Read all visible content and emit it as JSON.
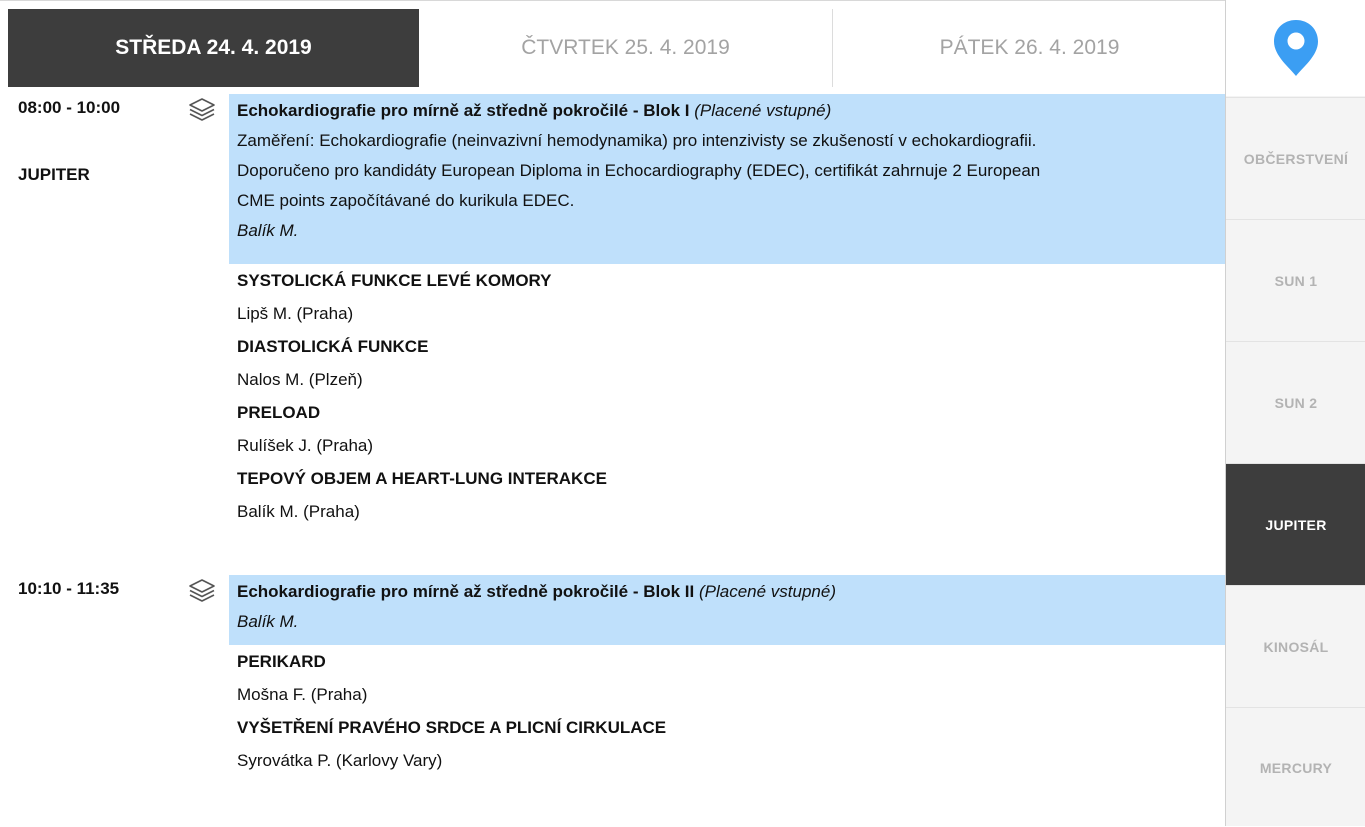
{
  "tabs": [
    {
      "label": "STŘEDA 24. 4. 2019",
      "active": true
    },
    {
      "label": "ČTVRTEK 25. 4. 2019",
      "active": false
    },
    {
      "label": "PÁTEK 26. 4. 2019",
      "active": false
    }
  ],
  "sidebar": {
    "pin_icon": "map-pin-icon",
    "rooms": [
      "OBČERSTVENÍ",
      "SUN 1",
      "SUN 2",
      "JUPITER",
      "KINOSÁL",
      "MERCURY"
    ],
    "active_room": "JUPITER"
  },
  "colors": {
    "active": "#3d3d3d",
    "session_bg": "#bfe0fb",
    "pin": "#3b9ef3"
  },
  "blocks": [
    {
      "time": "08:00 - 10:00",
      "room": "JUPITER",
      "icon": "layers-icon",
      "session": {
        "title": "Echokardiografie pro mírně až středně pokročilé - Blok I",
        "note": "(Placené vstupné)",
        "description": [
          "Zaměření: Echokardiografie (neinvazivní hemodynamika) pro intenzivisty se zkušeností v echokardiografii.",
          "Doporučeno pro kandidáty European Diploma in Echocardiography (EDEC), certifikát zahrnuje 2 European",
          "CME points započítávané do kurikula EDEC."
        ],
        "chair": "Balík M."
      },
      "talks": [
        {
          "title": "SYSTOLICKÁ FUNKCE LEVÉ KOMORY",
          "speaker": "Lipš M. (Praha)"
        },
        {
          "title": "DIASTOLICKÁ FUNKCE",
          "speaker": "Nalos M. (Plzeň)"
        },
        {
          "title": "PRELOAD",
          "speaker": "Rulíšek J. (Praha)"
        },
        {
          "title": "TEPOVÝ OBJEM A HEART-LUNG INTERAKCE",
          "speaker": "Balík M. (Praha)"
        }
      ]
    },
    {
      "time": "10:10 - 11:35",
      "icon": "layers-icon",
      "session": {
        "title": "Echokardiografie pro mírně až středně pokročilé - Blok II",
        "note": "(Placené vstupné)",
        "chair": "Balík M."
      },
      "talks": [
        {
          "title": "PERIKARD",
          "speaker": "Mošna F. (Praha)"
        },
        {
          "title": "VYŠETŘENÍ PRAVÉHO SRDCE A PLICNÍ CIRKULACE",
          "speaker": "Syrovátka P. (Karlovy Vary)"
        }
      ]
    }
  ]
}
